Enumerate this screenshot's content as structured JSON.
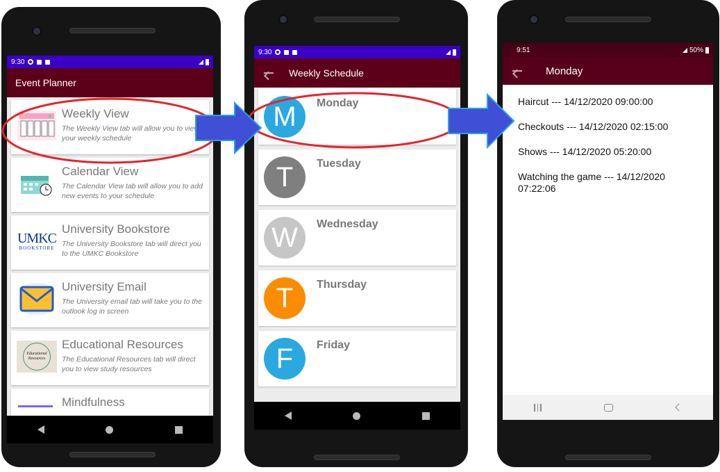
{
  "screen1": {
    "status": {
      "time": "9:30"
    },
    "title": "Event Planner",
    "cards": [
      {
        "title": "Weekly View",
        "desc": "The Weekly View tab will allow you to view your weekly schedule",
        "icon": "weekly-calendar-icon"
      },
      {
        "title": "Calendar View",
        "desc": "The Calendar View tab will allow you to add new events to your schedule",
        "icon": "calendar-clock-icon"
      },
      {
        "title": "University Bookstore",
        "desc": "The University Bookstore tab will direct you to the UMKC Bookstore",
        "icon": "umkc-bookstore-logo",
        "logo_top": "UMKC",
        "logo_bottom": "BOOKSTORE"
      },
      {
        "title": "University Email",
        "desc": "The University email tab will take you to the outlook log in screen",
        "icon": "envelope-icon"
      },
      {
        "title": "Educational Resources",
        "desc": "The Educational Resources tab will direct you to view study resources",
        "icon": "educational-resources-icon",
        "logo_text": "Educational Resources"
      },
      {
        "title": "Mindfulness",
        "desc": "",
        "icon": "mindfulness-icon"
      }
    ]
  },
  "screen2": {
    "status": {
      "time": "9:30"
    },
    "title": "Weekly Schedule",
    "days": [
      {
        "letter": "M",
        "name": "Monday",
        "color": "#29a9e0"
      },
      {
        "letter": "T",
        "name": "Tuesday",
        "color": "#7f7f7f"
      },
      {
        "letter": "W",
        "name": "Wednesday",
        "color": "#c6c6c6"
      },
      {
        "letter": "T",
        "name": "Thursday",
        "color": "#fb8c00"
      },
      {
        "letter": "F",
        "name": "Friday",
        "color": "#29a9e0"
      }
    ]
  },
  "screen3": {
    "status": {
      "time": "9:51",
      "battery": "50%"
    },
    "title": "Monday",
    "events": [
      "Haircut --- 14/12/2020 09:00:00",
      "Checkouts --- 14/12/2020 02:15:00",
      "Shows --- 14/12/2020 05:20:00",
      "Watching the game --- 14/12/2020 07:22:06"
    ]
  },
  "colors": {
    "appbar": "#5b0018",
    "statusbar_1_2": "#3a00c8",
    "statusbar_3": "#4a0016",
    "highlight": "#e4242c",
    "arrow": "#3f4fd6"
  }
}
